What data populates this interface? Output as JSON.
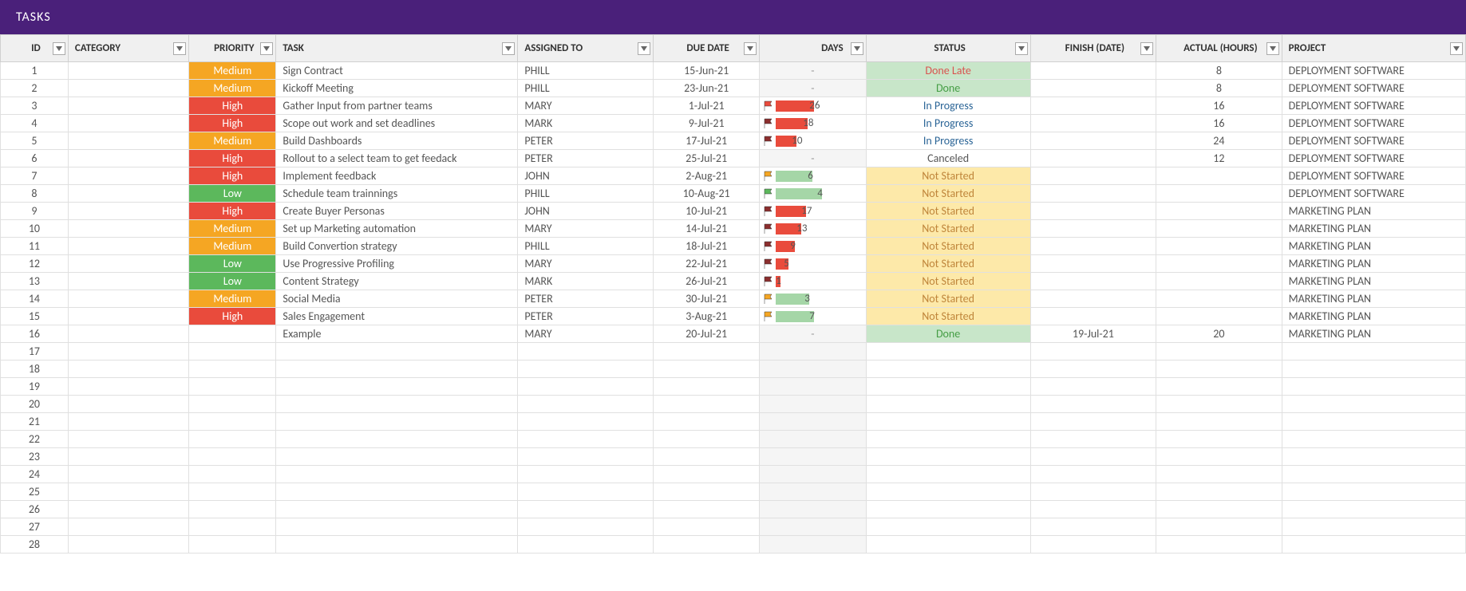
{
  "header": {
    "title": "TASKS"
  },
  "columns": {
    "id": "ID",
    "category": "CATEGORY",
    "priority": "PRIORITY",
    "task": "TASK",
    "assigned": "ASSIGNED TO",
    "due": "DUE DATE",
    "days": "DAYS",
    "status": "STATUS",
    "finish": "FINISH (DATE)",
    "actual": "ACTUAL (HOURS)",
    "project": "PROJECT"
  },
  "rows": [
    {
      "id": "1",
      "priority": "Medium",
      "task": "Sign Contract",
      "assigned": "PHILL",
      "due": "15-Jun-21",
      "days": "-",
      "status": "Done Late",
      "finish": "",
      "actual": "8",
      "project": "DEPLOYMENT SOFTWARE"
    },
    {
      "id": "2",
      "priority": "Medium",
      "task": "Kickoff Meeting",
      "assigned": "PHILL",
      "due": "23-Jun-21",
      "days": "-",
      "status": "Done",
      "finish": "",
      "actual": "8",
      "project": "DEPLOYMENT SOFTWARE"
    },
    {
      "id": "3",
      "priority": "High",
      "task": "Gather Input from partner teams",
      "assigned": "MARY",
      "due": "1-Jul-21",
      "days": "26",
      "days_flag": "red",
      "days_bar": "red",
      "days_barw": 48,
      "status": "In Progress",
      "finish": "",
      "actual": "16",
      "project": "DEPLOYMENT SOFTWARE"
    },
    {
      "id": "4",
      "priority": "High",
      "task": "Scope out work and set deadlines",
      "assigned": "MARK",
      "due": "9-Jul-21",
      "days": "18",
      "days_flag": "darkred",
      "days_bar": "red",
      "days_barw": 40,
      "status": "In Progress",
      "finish": "",
      "actual": "16",
      "project": "DEPLOYMENT SOFTWARE"
    },
    {
      "id": "5",
      "priority": "Medium",
      "task": "Build Dashboards",
      "assigned": "PETER",
      "due": "17-Jul-21",
      "days": "10",
      "days_flag": "darkred",
      "days_bar": "red",
      "days_barw": 26,
      "status": "In Progress",
      "finish": "",
      "actual": "24",
      "project": "DEPLOYMENT SOFTWARE"
    },
    {
      "id": "6",
      "priority": "High",
      "task": "Rollout to a select team to get feedack",
      "assigned": "PETER",
      "due": "25-Jul-21",
      "days": "-",
      "status": "Canceled",
      "finish": "",
      "actual": "12",
      "project": "DEPLOYMENT SOFTWARE"
    },
    {
      "id": "7",
      "priority": "High",
      "task": "Implement feedback",
      "assigned": "JOHN",
      "due": "2-Aug-21",
      "days": "6",
      "days_flag": "yellow",
      "days_bar": "green",
      "days_barw": 46,
      "status": "Not Started",
      "finish": "",
      "actual": "",
      "project": "DEPLOYMENT SOFTWARE"
    },
    {
      "id": "8",
      "priority": "Low",
      "task": "Schedule team trainnings",
      "assigned": "PHILL",
      "due": "10-Aug-21",
      "days": "4",
      "days_flag": "green",
      "days_bar": "green",
      "days_barw": 58,
      "status": "Not Started",
      "finish": "",
      "actual": "",
      "project": "DEPLOYMENT SOFTWARE"
    },
    {
      "id": "9",
      "priority": "High",
      "task": "Create Buyer Personas",
      "assigned": "JOHN",
      "due": "10-Jul-21",
      "days": "17",
      "days_flag": "darkred",
      "days_bar": "red",
      "days_barw": 38,
      "status": "Not Started",
      "finish": "",
      "actual": "",
      "project": "MARKETING PLAN"
    },
    {
      "id": "10",
      "priority": "Medium",
      "task": "Set up Marketing automation",
      "assigned": "MARY",
      "due": "14-Jul-21",
      "days": "13",
      "days_flag": "darkred",
      "days_bar": "red",
      "days_barw": 32,
      "status": "Not Started",
      "finish": "",
      "actual": "",
      "project": "MARKETING PLAN"
    },
    {
      "id": "11",
      "priority": "Medium",
      "task": "Build Convertion strategy",
      "assigned": "PHILL",
      "due": "18-Jul-21",
      "days": "9",
      "days_flag": "darkred",
      "days_bar": "red",
      "days_barw": 24,
      "status": "Not Started",
      "finish": "",
      "actual": "",
      "project": "MARKETING PLAN"
    },
    {
      "id": "12",
      "priority": "Low",
      "task": "Use Progressive Profiling",
      "assigned": "MARY",
      "due": "22-Jul-21",
      "days": "5",
      "days_flag": "darkred",
      "days_bar": "red",
      "days_barw": 16,
      "status": "Not Started",
      "finish": "",
      "actual": "",
      "project": "MARKETING PLAN"
    },
    {
      "id": "13",
      "priority": "Low",
      "task": "Content Strategy",
      "assigned": "MARK",
      "due": "26-Jul-21",
      "days": "1",
      "days_flag": "darkred",
      "days_bar": "red",
      "days_barw": 6,
      "status": "Not Started",
      "finish": "",
      "actual": "",
      "project": "MARKETING PLAN"
    },
    {
      "id": "14",
      "priority": "Medium",
      "task": "Social Media",
      "assigned": "PETER",
      "due": "30-Jul-21",
      "days": "3",
      "days_flag": "yellow",
      "days_bar": "green",
      "days_barw": 42,
      "status": "Not Started",
      "finish": "",
      "actual": "",
      "project": "MARKETING PLAN"
    },
    {
      "id": "15",
      "priority": "High",
      "task": "Sales Engagement",
      "assigned": "PETER",
      "due": "3-Aug-21",
      "days": "7",
      "days_flag": "yellow",
      "days_bar": "green",
      "days_barw": 48,
      "status": "Not Started",
      "finish": "",
      "actual": "",
      "project": "MARKETING PLAN"
    },
    {
      "id": "16",
      "priority": "",
      "task": "Example",
      "assigned": "MARY",
      "due": "20-Jul-21",
      "days": "-",
      "status": "Done",
      "finish": "19-Jul-21",
      "actual": "20",
      "project": "MARKETING PLAN"
    },
    {
      "id": "17"
    },
    {
      "id": "18"
    },
    {
      "id": "19"
    },
    {
      "id": "20"
    },
    {
      "id": "21"
    },
    {
      "id": "22"
    },
    {
      "id": "23"
    },
    {
      "id": "24"
    },
    {
      "id": "25"
    },
    {
      "id": "26"
    },
    {
      "id": "27"
    },
    {
      "id": "28"
    }
  ],
  "priority_class": {
    "Medium": "prio-medium",
    "High": "prio-high",
    "Low": "prio-low"
  },
  "status_class": {
    "Done Late": "status-done-late",
    "Done": "status-done",
    "In Progress": "status-inprogress",
    "Not Started": "status-notstarted",
    "Canceled": "status-canceled"
  }
}
